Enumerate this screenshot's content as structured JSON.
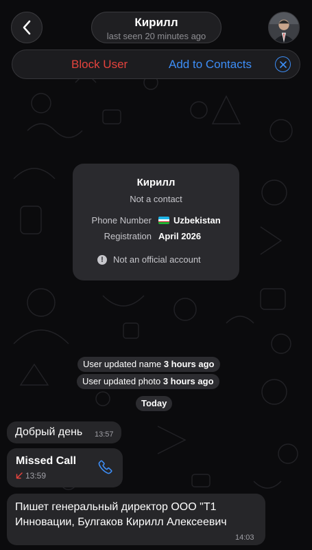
{
  "header": {
    "contact_name": "Кирилл",
    "last_seen": "last seen 20 minutes ago",
    "back_icon": "chevron-left-icon",
    "avatar_icon": "avatar"
  },
  "action_bar": {
    "block_label": "Block User",
    "add_label": "Add to Contacts",
    "close_icon": "close-icon",
    "block_color": "#e5433d",
    "add_color": "#3d8ef7"
  },
  "info_card": {
    "name": "Кирилл",
    "subtitle": "Not a contact",
    "phone_label": "Phone Number",
    "phone_value": "Uzbekistan",
    "registration_label": "Registration",
    "registration_value": "April 2026",
    "official_note": "Not an official account",
    "flag_icon": "uzbekistan-flag-icon",
    "warning_icon": "exclamation-icon"
  },
  "service": {
    "name_update_prefix": "User updated name",
    "name_update_time": "3 hours ago",
    "photo_update_prefix": "User updated photo",
    "photo_update_time": "3 hours ago",
    "date_divider": "Today"
  },
  "messages": [
    {
      "text": "Добрый день",
      "time": "13:57"
    },
    {
      "title": "Missed Call",
      "time": "13:59",
      "icon": "phone-icon",
      "arrow_icon": "missed-arrow-icon"
    },
    {
      "text": "Пишет генеральный директор ООО \"Т1 Инновации, Булгаков Кирилл Алексеевич",
      "time": "14:03"
    }
  ]
}
